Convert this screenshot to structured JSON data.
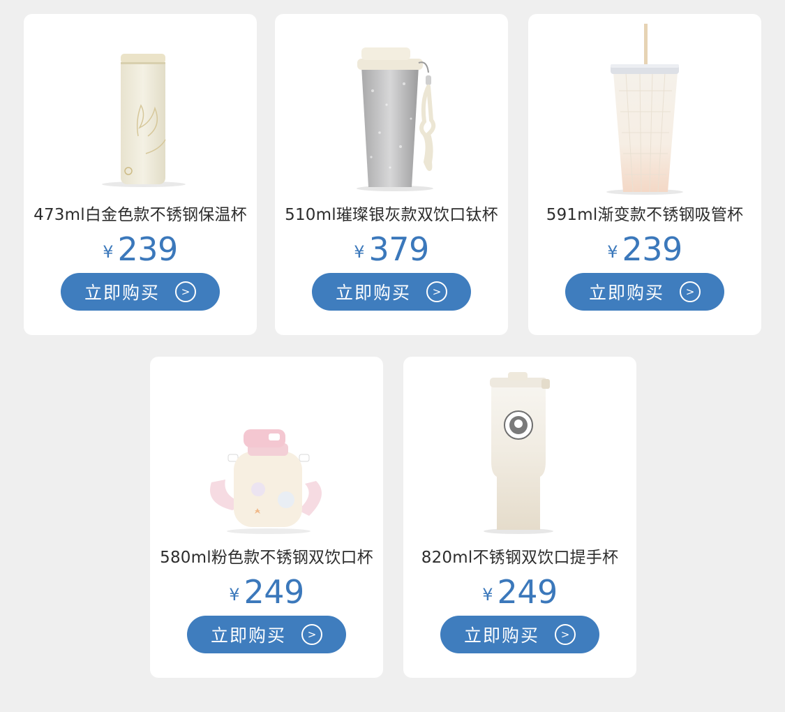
{
  "products": [
    {
      "title": "473ml白金色款不锈钢保温杯",
      "currency": "¥",
      "price": "239",
      "button_label": "立即购买",
      "button_icon": "arrow-right-circle-icon"
    },
    {
      "title": "510ml璀璨银灰款双饮口钛杯",
      "currency": "¥",
      "price": "379",
      "button_label": "立即购买",
      "button_icon": "arrow-right-circle-icon"
    },
    {
      "title": "591ml渐变款不锈钢吸管杯",
      "currency": "¥",
      "price": "239",
      "button_label": "立即购买",
      "button_icon": "arrow-right-circle-icon"
    },
    {
      "title": "580ml粉色款不锈钢双饮口杯",
      "currency": "¥",
      "price": "249",
      "button_label": "立即购买",
      "button_icon": "arrow-right-circle-icon"
    },
    {
      "title": "820ml不锈钢双饮口提手杯",
      "currency": "¥",
      "price": "249",
      "button_label": "立即购买",
      "button_icon": "arrow-right-circle-icon"
    }
  ],
  "colors": {
    "page_bg": "#efefef",
    "card_bg": "#ffffff",
    "accent": "#3f7dbe",
    "price": "#3b78bb",
    "text": "#2d2d2d"
  }
}
